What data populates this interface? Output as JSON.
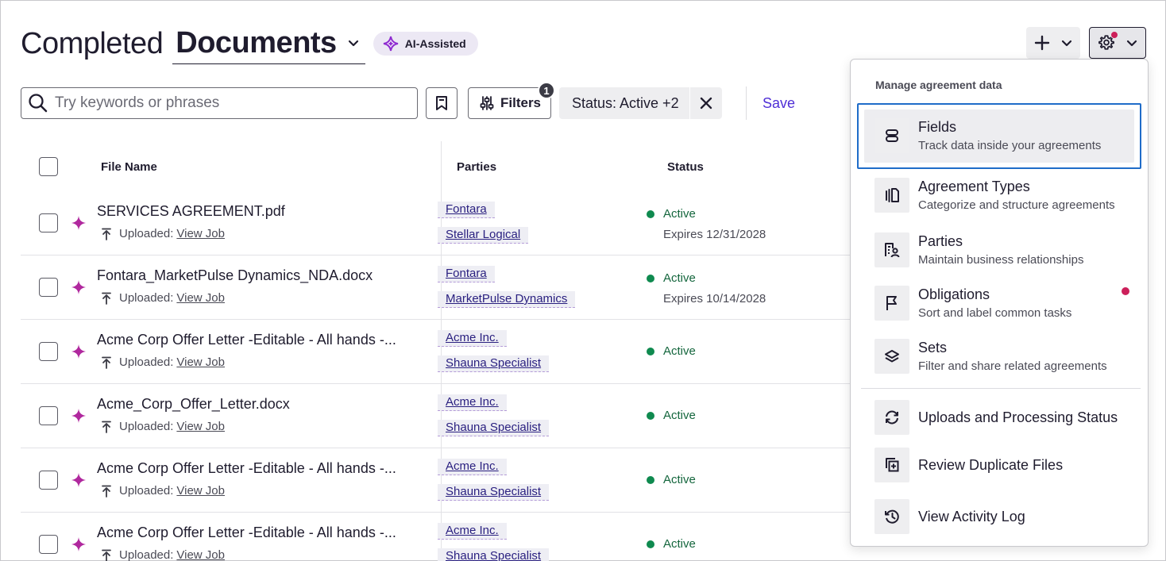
{
  "header": {
    "title_prefix": "Completed",
    "title_selected": "Documents",
    "ai_badge": "AI-Assisted"
  },
  "toolbar": {
    "search_placeholder": "Try keywords or phrases",
    "filters_label": "Filters",
    "filters_count": "1",
    "status_chip": "Status: Active +2",
    "save_label": "Save"
  },
  "table": {
    "columns": [
      "File Name",
      "Parties",
      "Status"
    ],
    "uploaded_label": "Uploaded:",
    "view_job_label": "View Job",
    "rows": [
      {
        "file": "SERVICES AGREEMENT.pdf",
        "parties": [
          "Fontara",
          "Stellar Logical"
        ],
        "status": "Active",
        "expires": "Expires 12/31/2028"
      },
      {
        "file": "Fontara_MarketPulse Dynamics_NDA.docx",
        "parties": [
          "Fontara",
          "MarketPulse Dynamics"
        ],
        "status": "Active",
        "expires": "Expires 10/14/2028"
      },
      {
        "file": "Acme Corp Offer Letter -Editable - All hands -...",
        "parties": [
          "Acme Inc.",
          "Shauna Specialist"
        ],
        "status": "Active",
        "expires": ""
      },
      {
        "file": "Acme_Corp_Offer_Letter.docx",
        "parties": [
          "Acme Inc.",
          "Shauna Specialist"
        ],
        "status": "Active",
        "expires": ""
      },
      {
        "file": "Acme Corp Offer Letter -Editable - All hands -...",
        "parties": [
          "Acme Inc.",
          "Shauna Specialist"
        ],
        "status": "Active",
        "expires": ""
      },
      {
        "file": "Acme Corp Offer Letter -Editable - All hands -...",
        "parties": [
          "Acme Inc.",
          "Shauna Specialist"
        ],
        "status": "Active",
        "expires": ""
      }
    ]
  },
  "menu": {
    "title": "Manage agreement data",
    "items": [
      {
        "title": "Fields",
        "subtitle": "Track data inside your agreements",
        "icon": "fields-icon"
      },
      {
        "title": "Agreement Types",
        "subtitle": "Categorize and structure agreements",
        "icon": "agreement-types-icon"
      },
      {
        "title": "Parties",
        "subtitle": "Maintain business relationships",
        "icon": "parties-icon"
      },
      {
        "title": "Obligations",
        "subtitle": "Sort and label common tasks",
        "icon": "flag-icon"
      },
      {
        "title": "Sets",
        "subtitle": "Filter and share related agreements",
        "icon": "layers-icon"
      },
      {
        "title": "Uploads and Processing Status",
        "subtitle": "",
        "icon": "sync-icon"
      },
      {
        "title": "Review Duplicate Files",
        "subtitle": "",
        "icon": "duplicate-icon"
      },
      {
        "title": "View Activity Log",
        "subtitle": "",
        "icon": "history-icon"
      }
    ]
  },
  "colors": {
    "accent_purple": "#4f2fd6",
    "sparkle_magenta": "#b0289e",
    "status_green": "#0f8a4f",
    "notification_red": "#cc1f5a",
    "focus_blue": "#1f6cc9"
  }
}
